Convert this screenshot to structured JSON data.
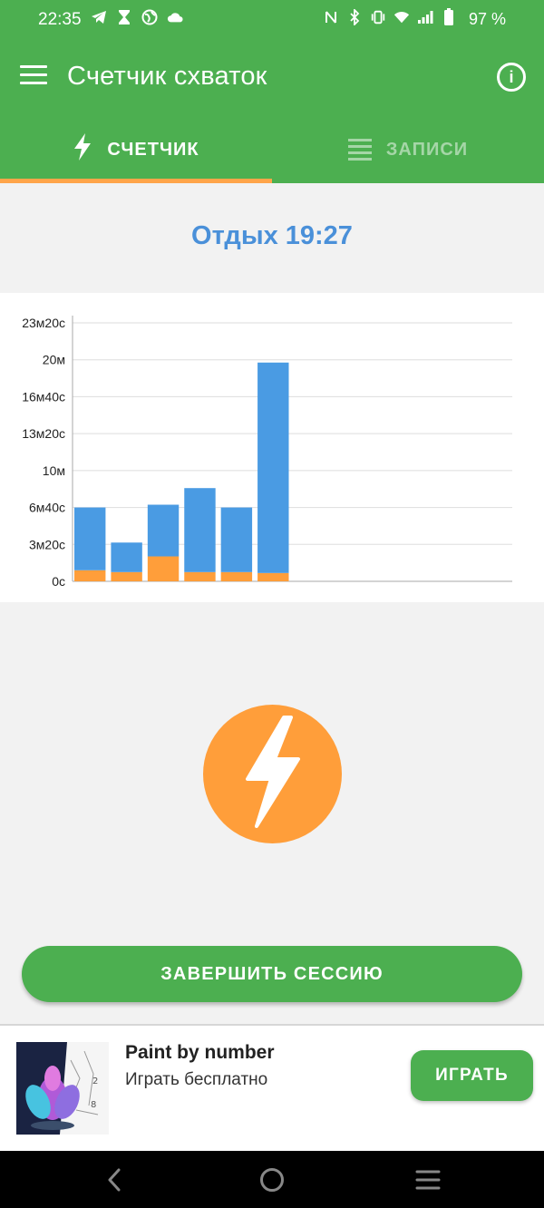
{
  "status_bar": {
    "time": "22:35",
    "battery": "97 %",
    "left_icons": [
      "telegram-icon",
      "hourglass-icon",
      "globe-icon",
      "cloud-icon"
    ],
    "right_icons": [
      "nfc-icon",
      "bluetooth-icon",
      "vibrate-icon",
      "wifi-icon",
      "signal-icon",
      "battery-icon"
    ]
  },
  "app_bar": {
    "title": "Счетчик схваток",
    "info_icon": "info-icon",
    "menu_icon": "hamburger-menu-icon"
  },
  "tabs": [
    {
      "label": "СЧЕТЧИК",
      "icon": "lightning-icon",
      "active": true
    },
    {
      "label": "ЗАПИСИ",
      "icon": "list-lines-icon",
      "active": false
    }
  ],
  "rest_status": "Отдых 19:27",
  "chart_data": {
    "type": "bar",
    "stacked": true,
    "y_tick_labels": [
      "0с",
      "3м20с",
      "6м40с",
      "10м",
      "13м20с",
      "16м40с",
      "20м",
      "23м20с"
    ],
    "y_unit": "seconds",
    "ylim": [
      0,
      1400
    ],
    "grid": true,
    "series": [
      {
        "color": "#ff9e3a",
        "values": [
          60,
          50,
          135,
          50,
          50,
          45
        ]
      },
      {
        "color": "#4a9be3",
        "values": [
          340,
          160,
          280,
          455,
          350,
          1140
        ]
      }
    ],
    "x_slots": 12
  },
  "main_button": {
    "icon": "lightning-icon",
    "color": "#ff9e3a"
  },
  "end_session_label": "ЗАВЕРШИТЬ СЕССИЮ",
  "ad": {
    "title": "Paint by number",
    "subtitle": "Играть бесплатно",
    "cta": "ИГРАТЬ",
    "thumb_icon": "lotus-paint-app-icon"
  },
  "nav_bar": [
    "back-icon",
    "home-icon",
    "recents-icon"
  ],
  "colors": {
    "primary": "#4caf50",
    "accent": "#ff9e3a",
    "rest_text": "#4a90d9",
    "tab_indicator": "#ffa54a"
  }
}
